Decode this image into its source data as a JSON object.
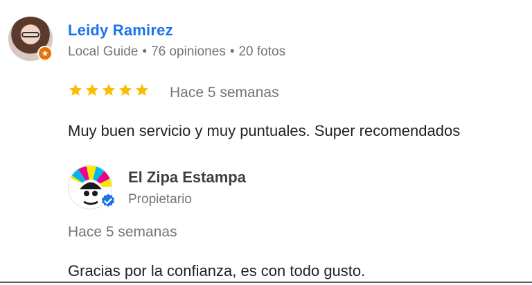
{
  "review": {
    "reviewer_name": "Leidy Ramirez",
    "reviewer_level": "Local Guide",
    "reviewer_reviews": "76 opiniones",
    "reviewer_photos": "20 fotos",
    "separator": "•",
    "rating": 5,
    "rating_max": 5,
    "date": "Hace 5 semanas",
    "text": "Muy buen servicio y muy puntuales. Super recomendados"
  },
  "owner_reply": {
    "name": "El Zipa Estampa",
    "role": "Propietario",
    "date": "Hace 5 semanas",
    "text": "Gracias por la confianza, es con todo gusto."
  },
  "icons": {
    "star": "star-icon",
    "local_guide_badge": "local-guide-badge-icon",
    "verified": "verified-check-icon"
  },
  "colors": {
    "name_blue": "#1a73e8",
    "star_gold": "#fbbc04",
    "muted_text": "#70757a",
    "badge_orange": "#e8710a",
    "verified_blue": "#1a73e8"
  }
}
